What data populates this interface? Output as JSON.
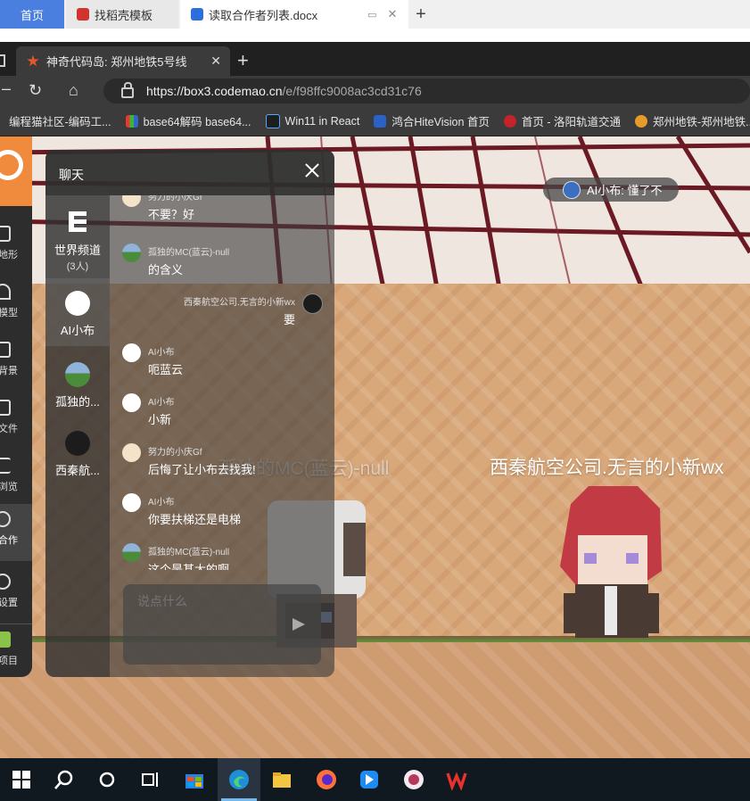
{
  "outer_tabs": [
    {
      "label": "首页"
    },
    {
      "label": "找稻壳模板"
    },
    {
      "label": "读取合作者列表.docx"
    }
  ],
  "edge": {
    "tab_title": "神奇代码岛: 郑州地铁5号线",
    "url_host": "https://box3.codemao.cn",
    "url_path": "/e/f98ffc9008ac3cd31c76",
    "bookmarks": [
      "编程猫社区-编码工...",
      "base64解码 base64...",
      "Win11 in React",
      "鸿合HiteVision 首页",
      "首页 - 洛阳轨道交通",
      "郑州地铁-郑州地铁..."
    ]
  },
  "game": {
    "bubble_text": "AI小布: 懂了不",
    "nametags": [
      "孤独的MC(蓝云)-null",
      "西秦航空公司.无言的小新wx"
    ],
    "sidebar": {
      "items": [
        "地形",
        "模型",
        "背景",
        "文件",
        "浏览",
        "合作",
        "设置",
        "项目"
      ]
    }
  },
  "chat": {
    "title": "聊天",
    "channels": [
      {
        "name": "世界频道",
        "count": "(3人)"
      },
      {
        "name": "AI小布"
      },
      {
        "name": "孤独的..."
      },
      {
        "name": "西秦航..."
      }
    ],
    "messages": [
      {
        "name": "努力的小庆Gf",
        "text": "不要？好"
      },
      {
        "name": "孤独的MC(蓝云)-null",
        "text": "的含义"
      },
      {
        "name": "西秦航空公司.无言的小新wx",
        "text": "要"
      },
      {
        "name": "AI小布",
        "text": "呃蓝云"
      },
      {
        "name": "AI小布",
        "text": "小新"
      },
      {
        "name": "努力的小庆Gf",
        "text": "后悔了让小布去找我!"
      },
      {
        "name": "AI小布",
        "text": "你要扶梯还是电梯"
      },
      {
        "name": "孤独的MC(蓝云)-null",
        "text": "这个是甚太的啊"
      }
    ],
    "input_placeholder": "说点什么"
  }
}
